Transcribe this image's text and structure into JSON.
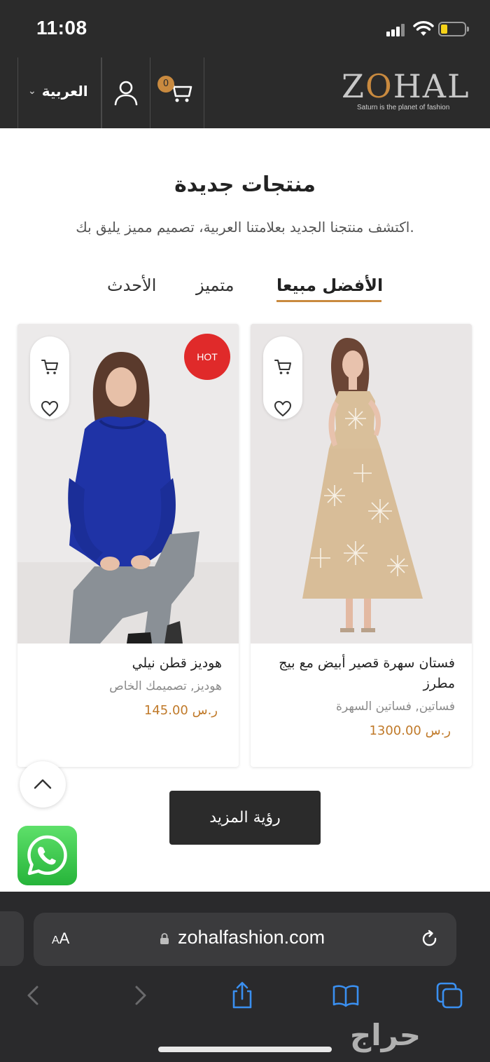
{
  "status_bar": {
    "time": "11:08"
  },
  "header": {
    "language": "العربية",
    "cart_count": "0",
    "logo_text_pre": "Z",
    "logo_text_o": "O",
    "logo_text_post": "HAL",
    "logo_tagline": "Saturn is the planet of fashion"
  },
  "section": {
    "title": "منتجات جديدة",
    "subtitle": "اكتشف منتجنا الجديد بعلامتنا العربية، تصميم مميز يليق بك."
  },
  "tabs": [
    {
      "label": "الأفضل مبيعا",
      "active": true
    },
    {
      "label": "متميز",
      "active": false
    },
    {
      "label": "الأحدث",
      "active": false
    }
  ],
  "products": [
    {
      "name": "فستان سهرة قصير أبيض مع بيج مطرز",
      "categories": "فساتين, فساتين السهرة",
      "price": "1300.00 ر.س",
      "badge": ""
    },
    {
      "name": "هوديز قطن نيلي",
      "categories": "هوديز, تصميمك الخاص",
      "price": "145.00 ر.س",
      "badge": "HOT"
    }
  ],
  "more_button": "رؤية المزيد",
  "browser": {
    "aa_label_small": "A",
    "aa_label_big": "A",
    "url": "zohalfashion.com"
  },
  "watermark": "حراج",
  "colors": {
    "header_bg": "#2b2b2b",
    "accent": "#c98a3f",
    "hot_badge": "#e02a2a",
    "whatsapp": "#26b43a"
  }
}
